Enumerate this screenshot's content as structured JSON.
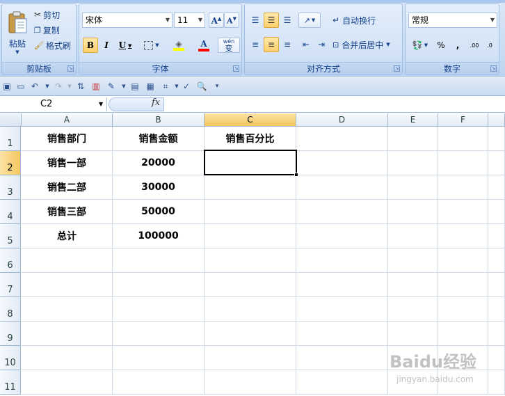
{
  "ribbon": {
    "clipboard": {
      "label": "剪贴板",
      "paste": "粘贴",
      "cut": "剪切",
      "copy": "复制",
      "format_painter": "格式刷"
    },
    "font": {
      "label": "字体",
      "font_name": "宋体",
      "font_size": "11",
      "bold": "B",
      "italic": "I",
      "underline": "U",
      "font_color_letter": "A",
      "phonetic": "wén",
      "phonetic_char": "变"
    },
    "alignment": {
      "label": "对齐方式",
      "wrap_text": "自动换行",
      "merge_center": "合并后居中"
    },
    "number": {
      "label": "数字",
      "format": "常规",
      "percent": "%",
      "comma": ",",
      "inc_decimal": ".00",
      "dec_decimal": ".0"
    }
  },
  "formula_bar": {
    "name_box": "C2",
    "fx": "fx",
    "content": ""
  },
  "columns": [
    "A",
    "B",
    "C",
    "D",
    "E",
    "F"
  ],
  "rows": [
    "1",
    "2",
    "3",
    "4",
    "5",
    "6",
    "7",
    "8",
    "9",
    "10",
    "11"
  ],
  "cells": {
    "A1": "销售部门",
    "B1": "销售金额",
    "C1": "销售百分比",
    "A2": "销售一部",
    "B2": "20000",
    "A3": "销售二部",
    "B3": "30000",
    "A4": "销售三部",
    "B4": "50000",
    "A5": "总计",
    "B5": "100000"
  },
  "watermark": {
    "brand": "Baidu经验",
    "url": "jingyan.baidu.com"
  },
  "colors": {
    "selected_header": "#f5c760",
    "active_border": "#000000",
    "ribbon_bg": "#c9dcf2"
  }
}
